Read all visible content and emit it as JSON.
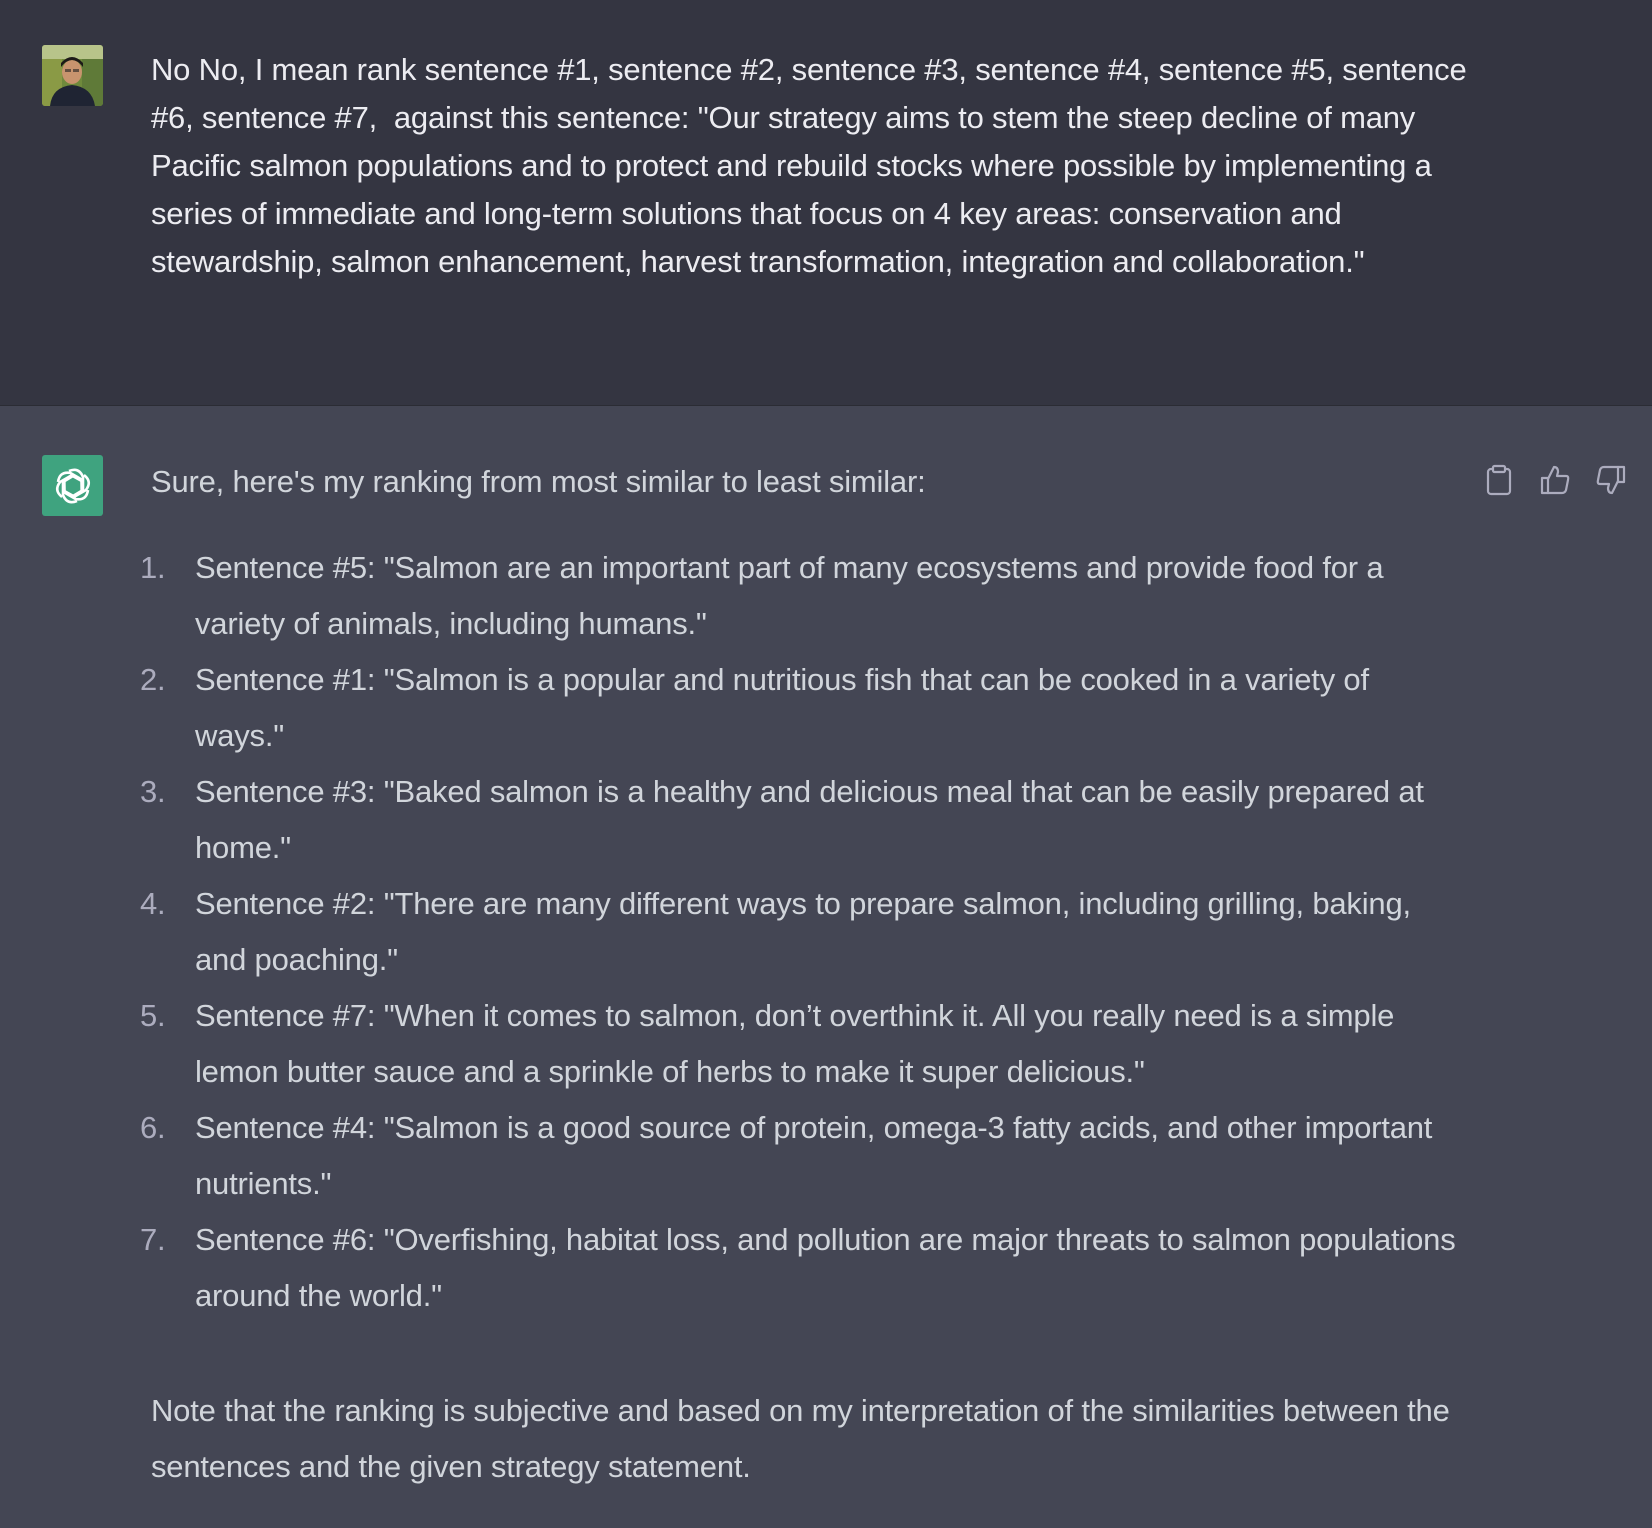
{
  "user_message": {
    "text": "No No, I mean rank sentence #1, sentence #2, sentence #3, sentence #4, sentence #5, sentence #6, sentence #7,  against this sentence: \"Our strategy aims to stem the steep decline of many Pacific salmon populations and to protect and rebuild stocks where possible by implementing a series of immediate and long-term solutions that focus on 4 key areas: conservation and stewardship, salmon enhancement, harvest transformation, integration and collaboration.\""
  },
  "assistant_message": {
    "intro": "Sure, here's my ranking from most similar to least similar:",
    "ranking": [
      {
        "num": "1.",
        "text": "Sentence #5: \"Salmon are an important part of many ecosystems and provide food for a variety of animals, including humans.\""
      },
      {
        "num": "2.",
        "text": "Sentence #1: \"Salmon is a popular and nutritious fish that can be cooked in a variety of ways.\""
      },
      {
        "num": "3.",
        "text": "Sentence #3: \"Baked salmon is a healthy and delicious meal that can be easily prepared at home.\""
      },
      {
        "num": "4.",
        "text": "Sentence #2: \"There are many different ways to prepare salmon, including grilling, baking, and poaching.\""
      },
      {
        "num": "5.",
        "text": "Sentence #7: \"When it comes to salmon, don’t overthink it. All you really need is a simple lemon butter sauce and a sprinkle of herbs to make it super delicious.\""
      },
      {
        "num": "6.",
        "text": "Sentence #4: \"Salmon is a good source of protein, omega-3 fatty acids, and other important nutrients.\""
      },
      {
        "num": "7.",
        "text": "Sentence #6: \"Overfishing, habitat loss, and pollution are major threats to salmon populations around the world.\""
      }
    ],
    "note": "Note that the ranking is subjective and based on my interpretation of the similarities between the sentences and the given strategy statement."
  },
  "icons": {
    "copy": "clipboard-icon",
    "like": "thumbs-up-icon",
    "dislike": "thumbs-down-icon",
    "bot": "openai-logo-icon"
  },
  "colors": {
    "user_bg": "#343541",
    "assistant_bg": "#444654",
    "bot_avatar": "#3fa37f",
    "text": "#d1d5db"
  }
}
